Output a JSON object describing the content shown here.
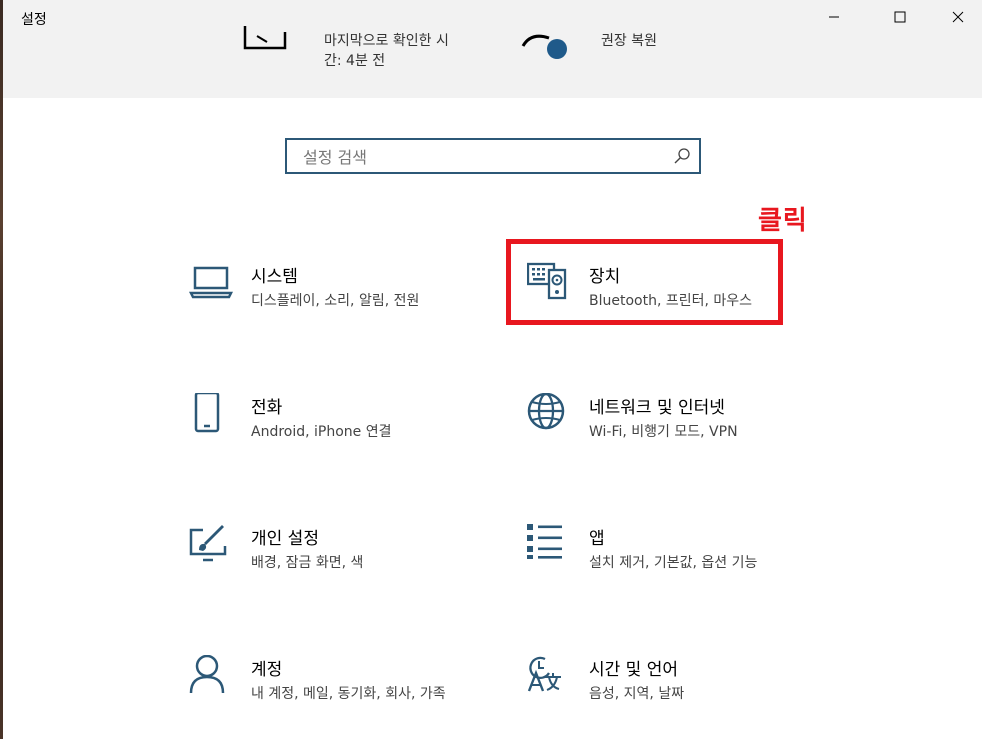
{
  "window": {
    "title": "설정",
    "controls": {
      "minimize": "minimize",
      "maximize": "maximize",
      "close": "close"
    }
  },
  "banner": {
    "left_line1": "마지막으로 확인한 시",
    "left_line2": "간: 4분 전",
    "right_line1": "권장 복원"
  },
  "search": {
    "placeholder": "설정 검색",
    "value": ""
  },
  "annotation": {
    "label": "클릭",
    "color": "#e8171f"
  },
  "tiles": [
    {
      "title": "시스템",
      "desc": "디스플레이, 소리, 알림, 전원",
      "icon": "laptop-icon"
    },
    {
      "title": "장치",
      "desc": "Bluetooth, 프린터, 마우스",
      "icon": "keyboard-speaker-icon"
    },
    {
      "title": "전화",
      "desc": "Android, iPhone 연결",
      "icon": "phone-icon"
    },
    {
      "title": "네트워크 및 인터넷",
      "desc": "Wi-Fi, 비행기 모드, VPN",
      "icon": "globe-icon"
    },
    {
      "title": "개인 설정",
      "desc": "배경, 잠금 화면, 색",
      "icon": "paint-icon"
    },
    {
      "title": "앱",
      "desc": "설치 제거, 기본값, 옵션 기능",
      "icon": "apps-list-icon"
    },
    {
      "title": "계정",
      "desc": "내 계정, 메일, 동기화, 회사, 가족",
      "icon": "person-icon"
    },
    {
      "title": "시간 및 언어",
      "desc": "음성, 지역, 날짜",
      "icon": "time-language-icon"
    }
  ],
  "colors": {
    "icon": "#2c5877",
    "accent": "#e8171f"
  }
}
